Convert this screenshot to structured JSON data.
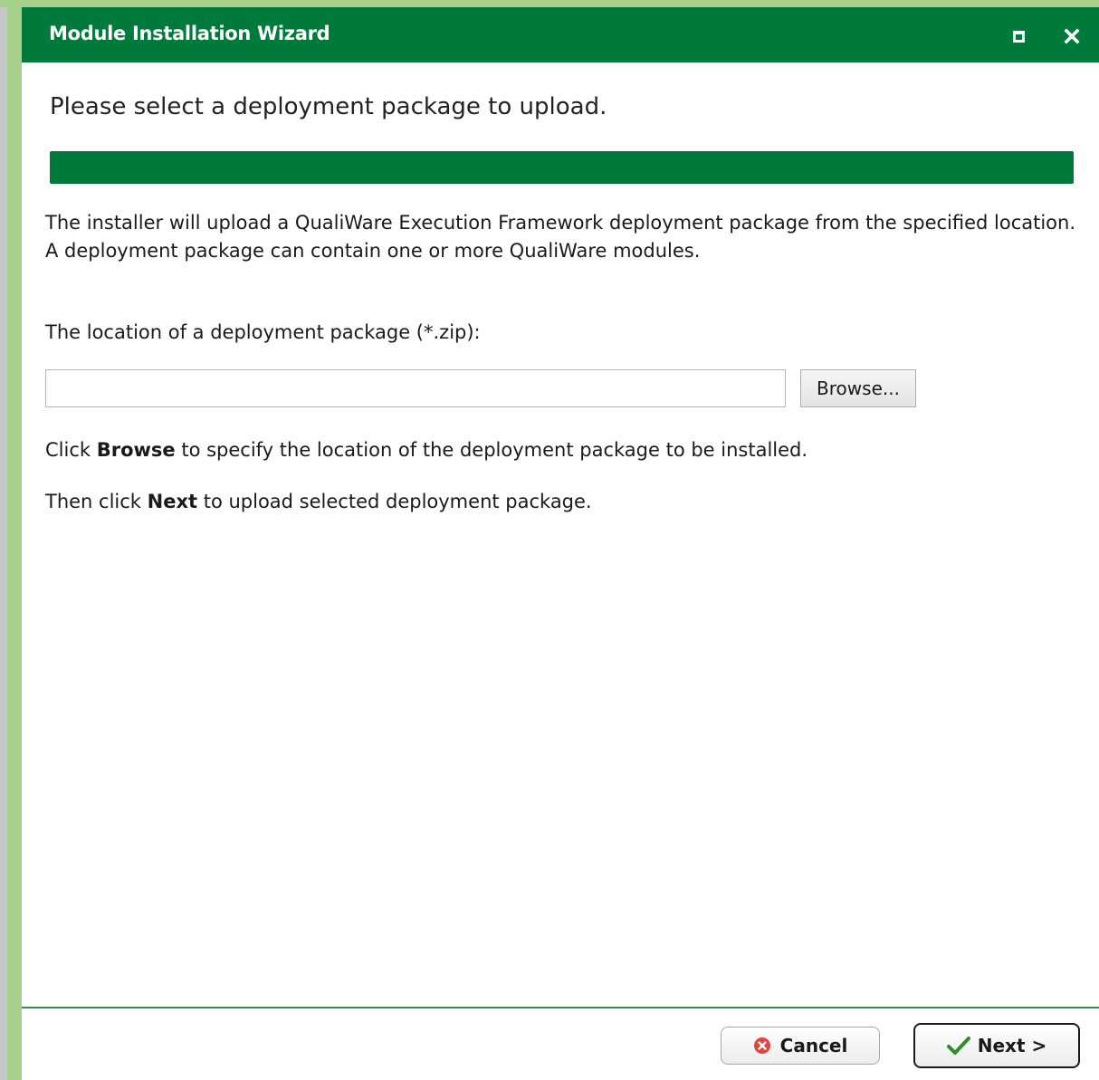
{
  "window": {
    "title": "Module Installation Wizard",
    "maximize_icon": "maximize-icon",
    "close_icon": "close-icon"
  },
  "step": {
    "heading": "Please select a deployment package to upload.",
    "progress_percent": 100,
    "progress_color": "#007a3b"
  },
  "content": {
    "intro_line1": "The installer will upload a QualiWare Execution Framework deployment package from the specified location.",
    "intro_line2": "A deployment package can contain one or more QualiWare modules.",
    "location_label": "The location of a deployment package (*.zip):",
    "file_input": {
      "value": "",
      "placeholder": ""
    },
    "browse_label": "Browse...",
    "hint_browse": {
      "prefix": "Click ",
      "bold": "Browse",
      "suffix": " to specify the location of the deployment package to be installed."
    },
    "hint_next": {
      "prefix": "Then click ",
      "bold": "Next",
      "suffix": " to upload selected deployment package."
    }
  },
  "footer": {
    "cancel_label": "Cancel",
    "cancel_icon": "cancel-circle-icon",
    "next_label": "Next >",
    "next_icon": "checkmark-icon"
  },
  "colors": {
    "brand_green": "#007a3b",
    "cancel_red": "#e0443a",
    "check_green": "#2e8b2e"
  }
}
